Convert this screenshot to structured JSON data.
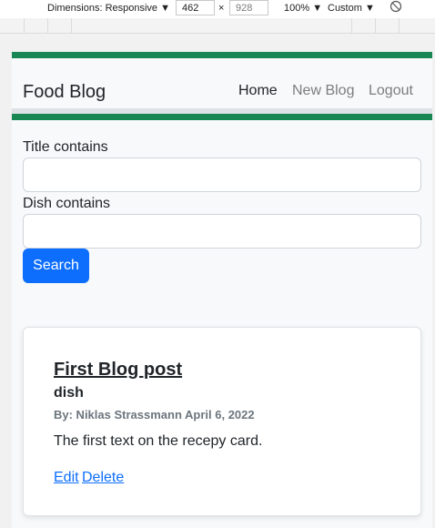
{
  "devtools": {
    "dimensions_label": "Dimensions: Responsive ▼",
    "width": "462",
    "times": "×",
    "height": "928",
    "zoom": "100% ▼",
    "throttle": "Custom ▼"
  },
  "nav": {
    "brand": "Food Blog",
    "links": [
      "Home",
      "New Blog",
      "Logout"
    ]
  },
  "search": {
    "title_label": "Title contains",
    "title_value": "",
    "dish_label": "Dish contains",
    "dish_value": "",
    "button": "Search"
  },
  "posts": [
    {
      "title": "First Blog post",
      "dish": "dish",
      "meta": "By: Niklas Strassmann April 6, 2022",
      "text": "The first text on the recepy card.",
      "edit": "Edit",
      "delete": "Delete"
    }
  ],
  "colors": {
    "accent_green": "#198754",
    "primary": "#0d6efd"
  }
}
